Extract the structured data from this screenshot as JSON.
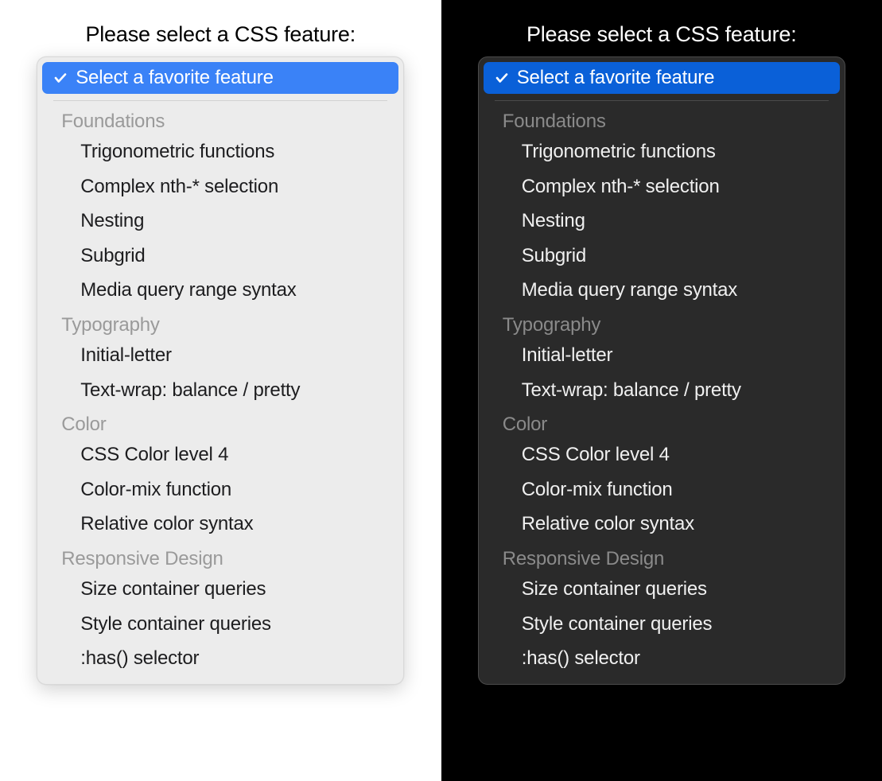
{
  "prompt": "Please select a CSS feature:",
  "selected_label": "Select a favorite feature",
  "colors": {
    "light_bg": "#ffffff",
    "dark_bg": "#000000",
    "light_dropdown_bg": "#ececec",
    "dark_dropdown_bg": "#2a2a2a",
    "light_highlight": "#3a82f7",
    "dark_highlight": "#0a60d8"
  },
  "groups": [
    {
      "label": "Foundations",
      "options": [
        "Trigonometric functions",
        "Complex nth-* selection",
        "Nesting",
        "Subgrid",
        "Media query range syntax"
      ]
    },
    {
      "label": "Typography",
      "options": [
        "Initial-letter",
        "Text-wrap: balance / pretty"
      ]
    },
    {
      "label": "Color",
      "options": [
        "CSS Color level 4",
        "Color-mix function",
        "Relative color syntax"
      ]
    },
    {
      "label": "Responsive Design",
      "options": [
        "Size container queries",
        "Style container queries",
        ":has() selector"
      ]
    }
  ]
}
